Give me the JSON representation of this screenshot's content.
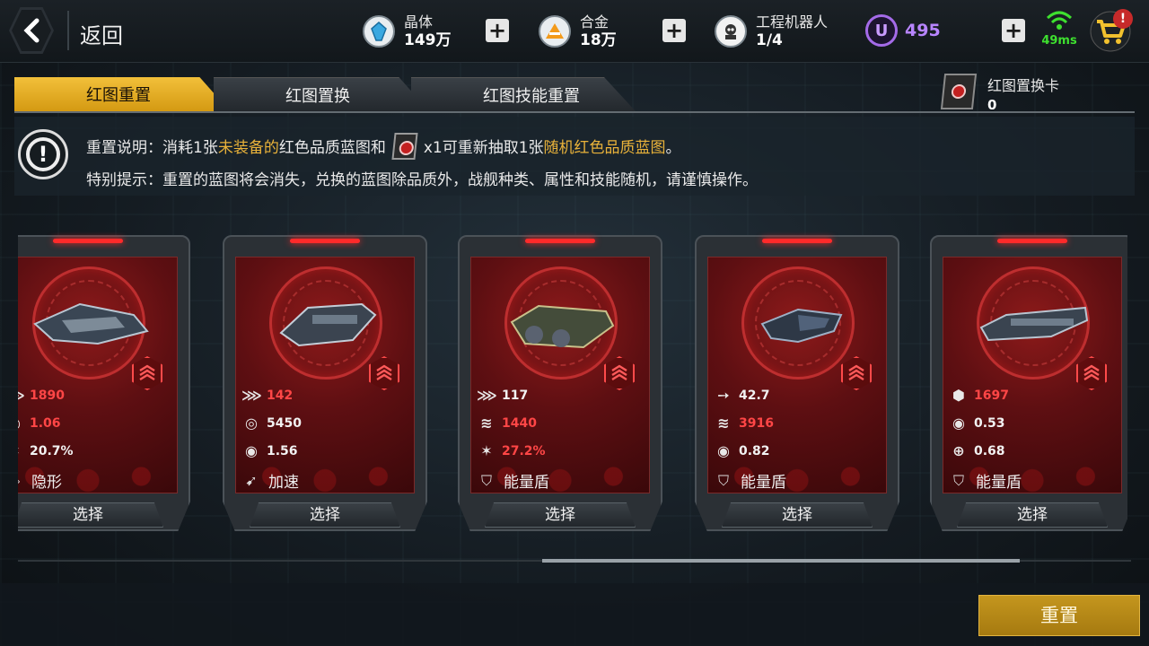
{
  "header": {
    "back_label": "返回",
    "resources": [
      {
        "name": "晶体",
        "value": "149万",
        "icon": "crystal-icon"
      },
      {
        "name": "合金",
        "value": "18万",
        "icon": "alloy-icon"
      },
      {
        "name": "工程机器人",
        "value": "1/4",
        "icon": "robot-icon"
      }
    ],
    "premium": {
      "value": "495",
      "icon_letter": "U"
    },
    "network": {
      "ping": "49ms"
    },
    "cart_badge": "!"
  },
  "tabs": [
    {
      "label": "红图重置",
      "active": true
    },
    {
      "label": "红图置换",
      "active": false
    },
    {
      "label": "红图技能重置",
      "active": false
    }
  ],
  "swap_card": {
    "name": "红图置换卡",
    "count": "0"
  },
  "info": {
    "line1": {
      "prefix": "重置说明：消耗1张",
      "hl1": "未装备的",
      "mid": "红色品质蓝图和",
      "mult": "x1可重新抽取1张",
      "hl2": "随机红色品质蓝图",
      "suffix": "。"
    },
    "line2": "特别提示：重置的蓝图将会消失，兑换的蓝图除品质外，战舰种类、属性和技能随机，请谨慎操作。"
  },
  "cards": [
    {
      "stats": [
        {
          "glyph": "⋙",
          "value": "1890",
          "red": true
        },
        {
          "glyph": "◉",
          "value": "1.06",
          "red": true
        },
        {
          "glyph": "✶",
          "value": "20.7%",
          "red": false
        }
      ],
      "skill": {
        "glyph": "◈",
        "label": "隐形"
      },
      "select": "选择"
    },
    {
      "stats": [
        {
          "glyph": "⋙",
          "value": "142",
          "red": true
        },
        {
          "glyph": "◎",
          "value": "5450",
          "red": false
        },
        {
          "glyph": "◉",
          "value": "1.56",
          "red": false
        }
      ],
      "skill": {
        "glyph": "➹",
        "label": "加速"
      },
      "select": "选择"
    },
    {
      "stats": [
        {
          "glyph": "⋙",
          "value": "117",
          "red": false
        },
        {
          "glyph": "≋",
          "value": "1440",
          "red": true
        },
        {
          "glyph": "✶",
          "value": "27.2%",
          "red": true
        }
      ],
      "skill": {
        "glyph": "⛉",
        "label": "能量盾"
      },
      "select": "选择"
    },
    {
      "stats": [
        {
          "glyph": "➙",
          "value": "42.7",
          "red": false
        },
        {
          "glyph": "≋",
          "value": "3916",
          "red": true
        },
        {
          "glyph": "◉",
          "value": "0.82",
          "red": false
        }
      ],
      "skill": {
        "glyph": "⛉",
        "label": "能量盾"
      },
      "select": "选择"
    },
    {
      "stats": [
        {
          "glyph": "⬢",
          "value": "1697",
          "red": true
        },
        {
          "glyph": "◉",
          "value": "0.53",
          "red": false
        },
        {
          "glyph": "⊕",
          "value": "0.68",
          "red": false
        }
      ],
      "skill": {
        "glyph": "⛉",
        "label": "能量盾"
      },
      "select": "选择"
    }
  ],
  "action": {
    "reset_label": "重置"
  },
  "colors": {
    "accent_gold": "#d8a21e",
    "stat_red": "#ff4646",
    "premium_purple": "#b885ff",
    "ping_green": "#3ee02f"
  }
}
